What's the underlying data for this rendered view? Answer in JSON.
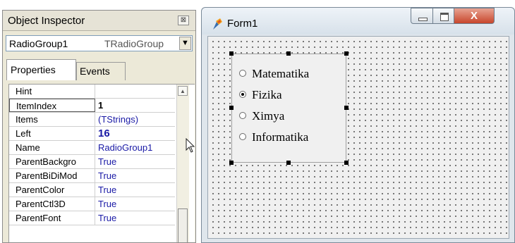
{
  "object_inspector": {
    "title": "Object Inspector",
    "close_glyph": "⊠",
    "component_name": "RadioGroup1",
    "component_type": "TRadioGroup",
    "combo_arrow": "▼",
    "tabs": [
      {
        "label": "Properties",
        "active": true
      },
      {
        "label": "Events",
        "active": false
      }
    ],
    "properties": [
      {
        "name": "Hint",
        "value": ""
      },
      {
        "name": "ItemIndex",
        "value": "1"
      },
      {
        "name": "Items",
        "value": "(TStrings)"
      },
      {
        "name": "Left",
        "value": "16"
      },
      {
        "name": "Name",
        "value": "RadioGroup1"
      },
      {
        "name": "ParentBackgro",
        "value": "True"
      },
      {
        "name": "ParentBiDiMod",
        "value": "True"
      },
      {
        "name": "ParentColor",
        "value": "True"
      },
      {
        "name": "ParentCtl3D",
        "value": "True"
      },
      {
        "name": "ParentFont",
        "value": "True"
      }
    ],
    "scroll_up_glyph": "▲"
  },
  "form": {
    "title": "Form1",
    "icon": "delphi-torch-icon",
    "close_glyph": "X",
    "radio_items": [
      {
        "label": "Matematika",
        "checked": false
      },
      {
        "label": "Fizika",
        "checked": true
      },
      {
        "label": "Ximya",
        "checked": false
      },
      {
        "label": "Informatika",
        "checked": false
      }
    ],
    "close_color": "#c8462c"
  }
}
